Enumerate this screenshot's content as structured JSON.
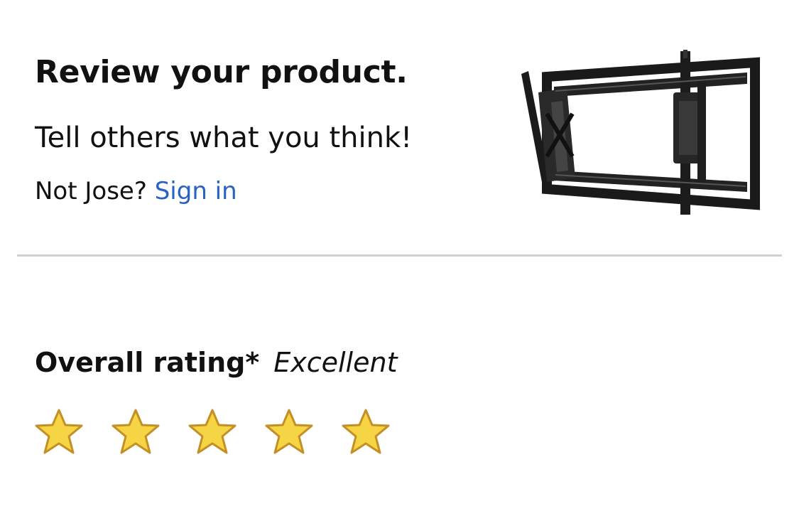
{
  "header": {
    "title": "Review your product.",
    "subtitle": "Tell others what you think!",
    "not_user_text": "Not Jose?",
    "sign_in_link": "Sign in"
  },
  "product": {
    "image_icon": "tv-wall-mount-image"
  },
  "rating": {
    "label": "Overall rating*",
    "value_text": "Excellent",
    "stars_selected": 5,
    "stars_total": 5,
    "star_fill_color": "#f6d544",
    "star_stroke_color": "#c48f25"
  },
  "colors": {
    "link": "#2a61c4",
    "divider": "#cdd1d6",
    "text": "#111111"
  }
}
